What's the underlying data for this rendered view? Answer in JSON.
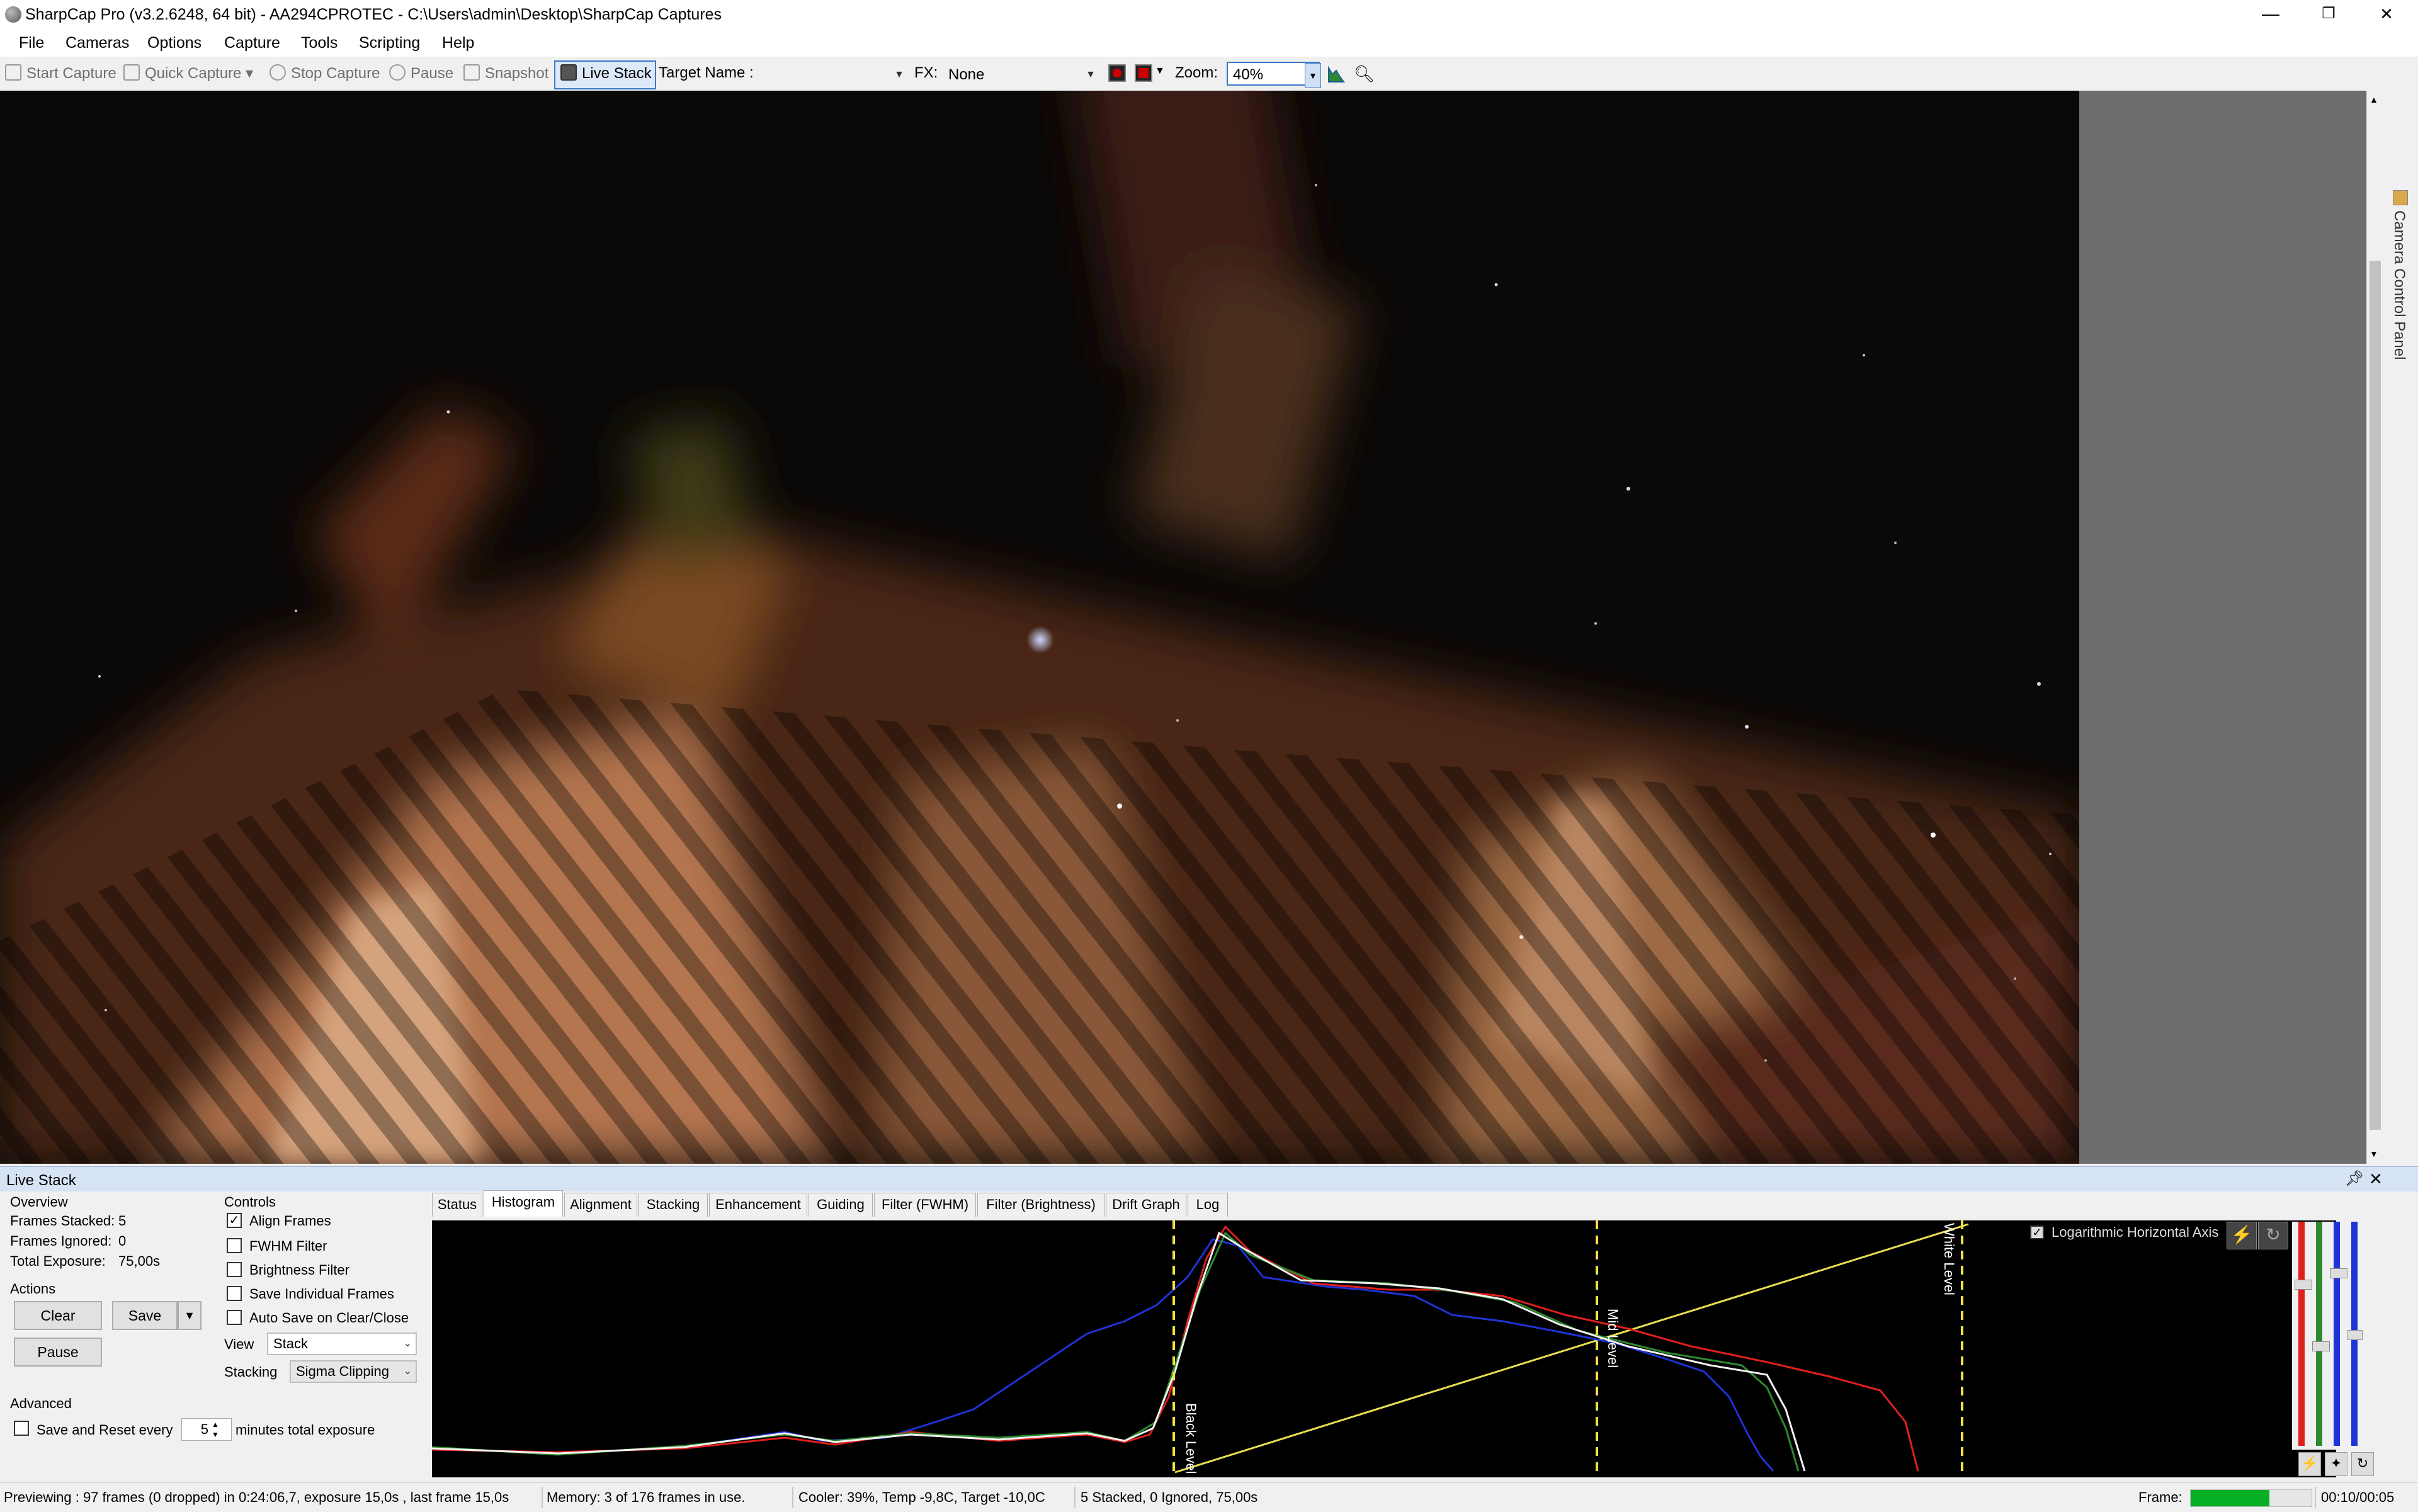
{
  "window": {
    "title": "SharpCap Pro (v3.2.6248, 64 bit) - AA294CPROTEC - C:\\Users\\admin\\Desktop\\SharpCap Captures",
    "minimize": "—",
    "restore": "❐",
    "close": "✕"
  },
  "menu": [
    "File",
    "Cameras",
    "Options",
    "Capture",
    "Tools",
    "Scripting",
    "Help"
  ],
  "toolbar": {
    "start_capture": "Start Capture",
    "quick_capture": "Quick Capture",
    "stop_capture": "Stop Capture",
    "pause": "Pause",
    "snapshot": "Snapshot",
    "live_stack": "Live Stack",
    "target_name_label": "Target Name :",
    "target_name_value": "",
    "fx_label": "FX:",
    "fx_value": "None",
    "zoom_label": "Zoom:",
    "zoom_value": "40%"
  },
  "side_panel": {
    "label": "Camera Control Panel"
  },
  "live_stack": {
    "title": "Live Stack",
    "overview": {
      "heading": "Overview",
      "frames_stacked_label": "Frames Stacked:",
      "frames_stacked": "5",
      "frames_ignored_label": "Frames Ignored:",
      "frames_ignored": "0",
      "total_exposure_label": "Total Exposure:",
      "total_exposure": "75,00s"
    },
    "actions": {
      "heading": "Actions",
      "clear": "Clear",
      "save": "Save",
      "pause": "Pause"
    },
    "advanced": {
      "heading": "Advanced",
      "save_reset_label": "Save and Reset every",
      "save_reset_value": "5",
      "save_reset_suffix": "minutes total exposure",
      "checked": false
    },
    "controls": {
      "heading": "Controls",
      "items": [
        {
          "label": "Align Frames",
          "checked": true
        },
        {
          "label": "FWHM Filter",
          "checked": false
        },
        {
          "label": "Brightness Filter",
          "checked": false
        },
        {
          "label": "Save Individual Frames",
          "checked": false
        },
        {
          "label": "Auto Save on Clear/Close",
          "checked": false
        }
      ],
      "view_label": "View",
      "view_value": "Stack",
      "stacking_label": "Stacking",
      "stacking_value": "Sigma Clipping"
    },
    "tabs": [
      "Status",
      "Histogram",
      "Alignment",
      "Stacking",
      "Enhancement",
      "Guiding",
      "Filter (FWHM)",
      "Filter (Brightness)",
      "Drift Graph",
      "Log"
    ],
    "active_tab": "Histogram",
    "histogram": {
      "log_axis_label": "Logarithmic Horizontal Axis",
      "log_axis_checked": true,
      "black_level_label": "Black Level",
      "mid_level_label": "Mid Level",
      "white_level_label": "White Level",
      "colors": {
        "red": "#e0201c",
        "green": "#2f8a2f",
        "blue": "#1f33d6",
        "white": "#f2f2f2",
        "levels": "#f0e040"
      }
    }
  },
  "status": {
    "previewing": "Previewing : 97 frames (0 dropped) in 0:24:06,7, exposure 15,0s , last frame 15,0s",
    "memory": "Memory: 3 of 176 frames in use.",
    "cooler": "Cooler: 39%, Temp -9,8C, Target -10,0C",
    "stack": "5 Stacked, 0 Ignored, 75,00s",
    "frame_label": "Frame:",
    "frame_time": "00:10/00:05",
    "frame_progress": 0.65
  }
}
